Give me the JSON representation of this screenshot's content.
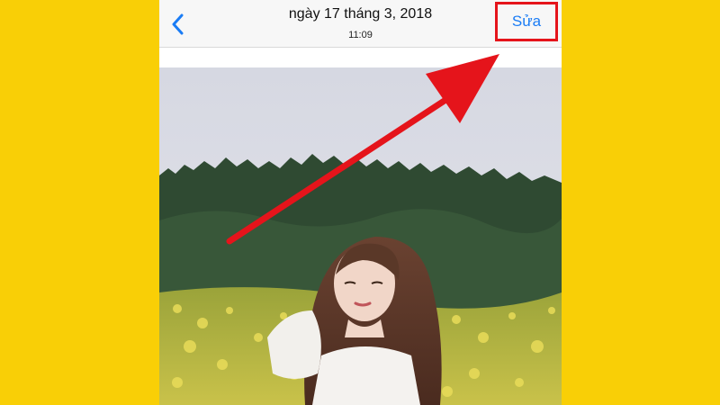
{
  "navbar": {
    "back_icon": "chevron-left-icon",
    "date": "ngày 17 tháng 3, 2018",
    "time": "11:09",
    "edit_label": "Sửa"
  },
  "colors": {
    "background": "#f9cf06",
    "accent": "#1a7cf5",
    "highlight": "#e5141b"
  },
  "annotation": {
    "type": "arrow",
    "target": "edit-button"
  }
}
